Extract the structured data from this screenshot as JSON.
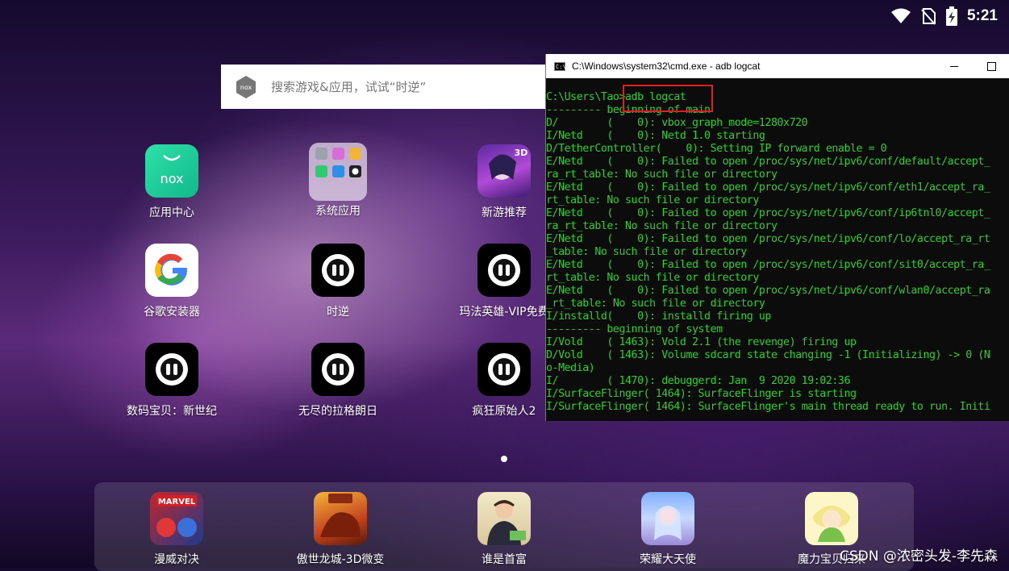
{
  "statusbar": {
    "time": "5:21"
  },
  "search": {
    "placeholder": "搜索游戏&应用，试试“时逆”"
  },
  "apps": [
    {
      "label": "应用中心",
      "icon": "nox-app-center-icon"
    },
    {
      "label": "系统应用",
      "icon": "system-apps-folder-icon"
    },
    {
      "label": "新游推荐",
      "icon": "new-games-icon"
    },
    {
      "label": "谷歌安装器",
      "icon": "google-installer-icon"
    },
    {
      "label": "时逆",
      "icon": "game-icon"
    },
    {
      "label": "玛法英雄-VIP免费",
      "icon": "game-icon"
    },
    {
      "label": "数码宝贝：新世纪",
      "icon": "game-icon"
    },
    {
      "label": "无尽的拉格朗日",
      "icon": "game-icon"
    },
    {
      "label": "疯狂原始人2",
      "icon": "game-icon"
    }
  ],
  "dock": [
    {
      "label": "漫威对决",
      "icon": "marvel-icon"
    },
    {
      "label": "傲世龙城-3D微变",
      "icon": "dragon-city-icon"
    },
    {
      "label": "谁是首富",
      "icon": "richest-icon"
    },
    {
      "label": "荣耀大天使",
      "icon": "archangel-icon"
    },
    {
      "label": "魔力宝贝归来",
      "icon": "crossgate-icon"
    }
  ],
  "cmd": {
    "title": "C:\\Windows\\system32\\cmd.exe - adb  logcat",
    "lines": [
      "C:\\Users\\Tao>adb logcat",
      "--------- beginning of main",
      "D/        (    0): vbox_graph_mode=1280x720",
      "I/Netd    (    0): Netd 1.0 starting",
      "D/TetherController(    0): Setting IP forward enable = 0",
      "E/Netd    (    0): Failed to open /proc/sys/net/ipv6/conf/default/accept_",
      "ra_rt_table: No such file or directory",
      "E/Netd    (    0): Failed to open /proc/sys/net/ipv6/conf/eth1/accept_ra_",
      "rt_table: No such file or directory",
      "E/Netd    (    0): Failed to open /proc/sys/net/ipv6/conf/ip6tnl0/accept_",
      "ra_rt_table: No such file or directory",
      "E/Netd    (    0): Failed to open /proc/sys/net/ipv6/conf/lo/accept_ra_rt",
      "_table: No such file or directory",
      "E/Netd    (    0): Failed to open /proc/sys/net/ipv6/conf/sit0/accept_ra_",
      "rt_table: No such file or directory",
      "E/Netd    (    0): Failed to open /proc/sys/net/ipv6/conf/wlan0/accept_ra",
      "_rt_table: No such file or directory",
      "I/installd(    0): installd firing up",
      "--------- beginning of system",
      "I/Vold    ( 1463): Vold 2.1 (the revenge) firing up",
      "D/Vold    ( 1463): Volume sdcard state changing -1 (Initializing) -> 0 (N",
      "o-Media)",
      "I/        ( 1470): debuggerd: Jan  9 2020 19:02:36",
      "I/SurfaceFlinger( 1464): SurfaceFlinger is starting",
      "I/SurfaceFlinger( 1464): SurfaceFlinger's main thread ready to run. Initi"
    ]
  },
  "watermark": "CSDN @浓密头发-李先森"
}
